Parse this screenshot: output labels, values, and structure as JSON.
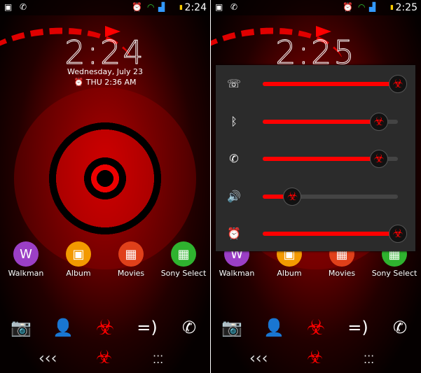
{
  "screens": [
    {
      "status": {
        "time": "2:24"
      },
      "clock": "2:24",
      "date": "Wednesday, July 23",
      "alarm": "THU 2:36 AM"
    },
    {
      "status": {
        "time": "2:25"
      },
      "clock": "2:25"
    }
  ],
  "apps": [
    {
      "label": "Walkman",
      "color": "#9b3fc6",
      "icon": "walkman-icon",
      "glyph": "W"
    },
    {
      "label": "Album",
      "color": "#f39a00",
      "icon": "album-icon",
      "glyph": "▣"
    },
    {
      "label": "Movies",
      "color": "#e0401a",
      "icon": "movies-icon",
      "glyph": "▦"
    },
    {
      "label": "Sony Select",
      "color": "#2fb32f",
      "icon": "sony-select-icon",
      "glyph": "▦"
    }
  ],
  "dock": [
    {
      "icon": "camera-icon",
      "glyph": "📷"
    },
    {
      "icon": "contacts-icon",
      "glyph": "👤"
    },
    {
      "icon": "biohazard-app-drawer-icon",
      "glyph": "☣"
    },
    {
      "icon": "messaging-icon",
      "glyph": "=)"
    },
    {
      "icon": "phone-icon",
      "glyph": "✆"
    }
  ],
  "volume": [
    {
      "icon": "ringtone-icon",
      "glyph": "☏",
      "percent": 100
    },
    {
      "icon": "bluetooth-icon",
      "glyph": "ᛒ",
      "percent": 86
    },
    {
      "icon": "call-volume-icon",
      "glyph": "✆",
      "percent": 86
    },
    {
      "icon": "media-volume-icon",
      "glyph": "🔊",
      "percent": 22
    },
    {
      "icon": "alarm-volume-icon",
      "glyph": "⏰",
      "percent": 100
    }
  ],
  "accent": "#ff0000"
}
